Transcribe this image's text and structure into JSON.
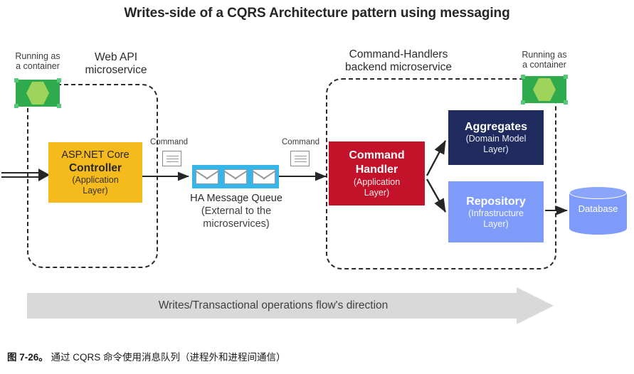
{
  "title": "Writes-side of a CQRS Architecture pattern using messaging",
  "containers": {
    "left": {
      "label_line1": "Running as",
      "label_line2": "a container",
      "icon": "container-hexagon-icon"
    },
    "right": {
      "label_line1": "Running as",
      "label_line2": "a container",
      "icon": "container-hexagon-icon"
    }
  },
  "microservices": {
    "webapi": {
      "caption_line1": "Web API",
      "caption_line2": "microservice"
    },
    "handlers": {
      "caption_line1": "Command-Handlers",
      "caption_line2": "backend microservice"
    }
  },
  "boxes": {
    "controller": {
      "line1": "ASP.NET Core",
      "line2": "Controller",
      "sub1": "(Application",
      "sub2": "Layer)",
      "color": "#f5ba1c",
      "text_color": "#262626"
    },
    "command_handler": {
      "line1": "Command",
      "line2": "Handler",
      "sub1": "(Application",
      "sub2": "Layer)",
      "color": "#c3122a",
      "text_color": "#ffffff"
    },
    "aggregates": {
      "line1": "Aggregates",
      "sub1": "(Domain Model",
      "sub2": "Layer)",
      "color": "#1f2a5e",
      "text_color": "#ffffff"
    },
    "repository": {
      "line1": "Repository",
      "sub1": "(Infrastructure",
      "sub2": "Layer)",
      "color": "#7f9bfa",
      "text_color": "#ffffff"
    }
  },
  "queue": {
    "label_line1": "HA Message Queue",
    "label_line2": "(External to the",
    "label_line3": "microservices)",
    "color": "#35b6ea",
    "message_count": 3,
    "message_icon": "envelope-icon"
  },
  "commands": {
    "first": {
      "label": "Command",
      "icon": "document-icon"
    },
    "second": {
      "label": "Command",
      "icon": "document-icon"
    }
  },
  "database": {
    "label": "Database",
    "color": "#7f9bfa",
    "icon": "database-cylinder-icon"
  },
  "flow_banner": {
    "text": "Writes/Transactional operations flow's direction",
    "color": "#d9d9d9"
  },
  "figure_caption": {
    "number": "图 7-26。",
    "text": " 通过 CQRS 命令使用消息队列（进程外和进程间通信）"
  }
}
